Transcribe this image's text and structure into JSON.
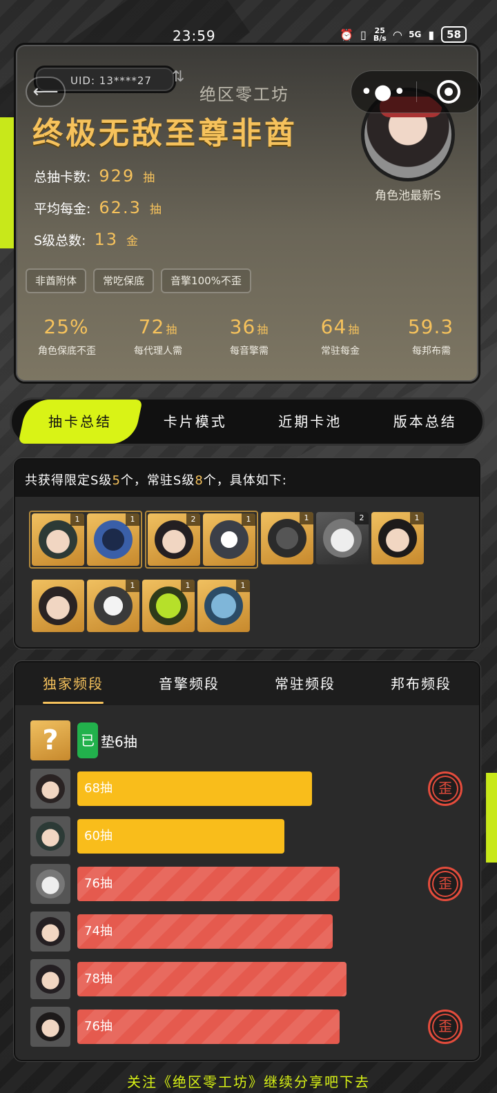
{
  "status_bar": {
    "time": "23:59",
    "speed_value": "25",
    "speed_unit": "B/s",
    "network": "5G",
    "battery": "58"
  },
  "header": {
    "uid": "UID: 13****27",
    "app_name": "绝区零工坊",
    "title": "终极无敌至尊非酋",
    "avatar_label": "角色池最新S"
  },
  "stats": [
    {
      "label": "总抽卡数:",
      "value": "929",
      "unit": "抽"
    },
    {
      "label": "平均每金:",
      "value": "62.3",
      "unit": "抽"
    },
    {
      "label": "S级总数:",
      "value": "13",
      "unit": "金"
    }
  ],
  "tags": [
    "非酋附体",
    "常吃保底",
    "音擎100%不歪"
  ],
  "metrics": [
    {
      "value": "25%",
      "unit": "",
      "label": "角色保底不歪"
    },
    {
      "value": "72",
      "unit": "抽",
      "label": "每代理人需"
    },
    {
      "value": "36",
      "unit": "抽",
      "label": "每音擎需"
    },
    {
      "value": "64",
      "unit": "抽",
      "label": "常驻每金"
    },
    {
      "value": "59.3",
      "unit": "",
      "label": "每邦布需"
    }
  ],
  "main_tabs": [
    "抽卡总结",
    "卡片模式",
    "近期卡池",
    "版本总结"
  ],
  "summary": {
    "prefix": "共获得限定S级",
    "limited_count": "5",
    "middle": "个，常驻S级",
    "standard_count": "8",
    "suffix": "个，具体如下:"
  },
  "items_row1_groups": [
    [
      "1",
      "1"
    ],
    [
      "2",
      "1"
    ]
  ],
  "items_row1_single": [
    "1",
    "2",
    "1"
  ],
  "items_row2": [
    "",
    "1",
    "1",
    "1"
  ],
  "freq_tabs": [
    "独家频段",
    "音擎频段",
    "常驻频段",
    "邦布频段"
  ],
  "pity": {
    "question": "?",
    "badge": "已",
    "text": "垫6抽"
  },
  "pulls": [
    {
      "label": "68抽",
      "value": 68,
      "type": "gold",
      "off_rate": true
    },
    {
      "label": "60抽",
      "value": 60,
      "type": "gold",
      "off_rate": false
    },
    {
      "label": "76抽",
      "value": 76,
      "type": "red",
      "off_rate": true
    },
    {
      "label": "74抽",
      "value": 74,
      "type": "red",
      "off_rate": false
    },
    {
      "label": "78抽",
      "value": 78,
      "type": "red",
      "off_rate": false
    },
    {
      "label": "76抽",
      "value": 76,
      "type": "red",
      "off_rate": true
    }
  ],
  "off_rate_mark": "歪",
  "footer": "关注《绝区零工坊》继续分享吧下去"
}
